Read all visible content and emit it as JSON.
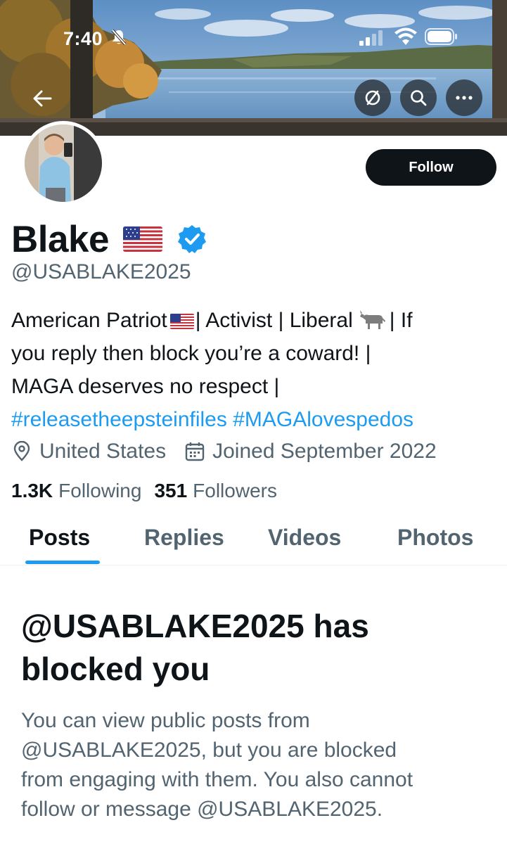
{
  "status_bar": {
    "time": "7:40",
    "icons": [
      "bell-slash-icon",
      "cellular-signal-icon",
      "wifi-icon",
      "battery-icon"
    ]
  },
  "header": {
    "buttons": [
      "back-arrow-icon",
      "translate-icon",
      "search-icon",
      "more-icon"
    ]
  },
  "profile": {
    "name": "Blake",
    "name_emoji": "us-flag-icon",
    "verified_icon": "verified-badge-icon",
    "handle": "@USABLAKE2025",
    "follow_label": "Follow",
    "bio": {
      "line1_a": "American Patriot",
      "line1_b": "| Activist | Liberal",
      "line1_c": "| If",
      "line2": "you reply then block you’re a coward! |",
      "line3": "MAGA deserves no respect |",
      "hashtag1": "#releasetheepsteinfiles",
      "hashtag2": "#MAGAlovespedos"
    },
    "location": "United States",
    "joined": "Joined September 2022",
    "following_count": "1.3K",
    "following_label": "Following",
    "followers_count": "351",
    "followers_label": "Followers"
  },
  "tabs": [
    {
      "label": "Posts",
      "active": true
    },
    {
      "label": "Replies",
      "active": false
    },
    {
      "label": "Videos",
      "active": false
    },
    {
      "label": "Photos",
      "active": false
    }
  ],
  "blocked": {
    "title_line1": "@USABLAKE2025 has",
    "title_line2": "blocked you",
    "body_line1": "You can view public posts from",
    "body_line2": "@USABLAKE2025, but you are blocked",
    "body_line3": "from engaging with them. You also cannot",
    "body_line4": "follow or message @USABLAKE2025."
  },
  "colors": {
    "accent": "#1d9bf0",
    "text_primary": "#0f1419",
    "text_secondary": "#536471",
    "follow_bg": "#0f1419"
  }
}
